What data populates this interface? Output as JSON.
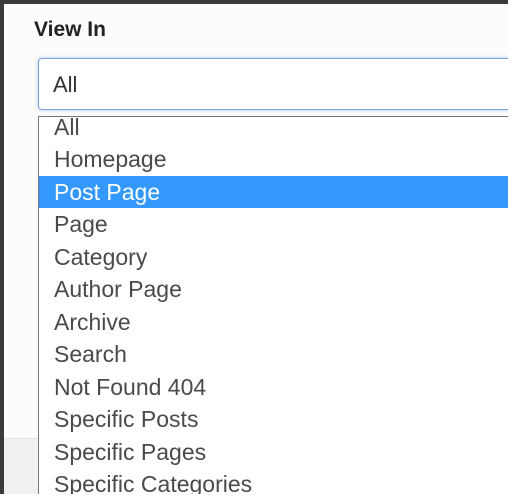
{
  "field": {
    "label": "View In",
    "selected_value": "All"
  },
  "dropdown": {
    "options": [
      "All",
      "Homepage",
      "Post Page",
      "Page",
      "Category",
      "Author Page",
      "Archive",
      "Search",
      "Not Found 404",
      "Specific Posts",
      "Specific Pages",
      "Specific Categories"
    ],
    "highlighted_option": "Post Page"
  },
  "colors": {
    "highlight": "#3399ff",
    "focus_border": "#7ea7d8"
  }
}
